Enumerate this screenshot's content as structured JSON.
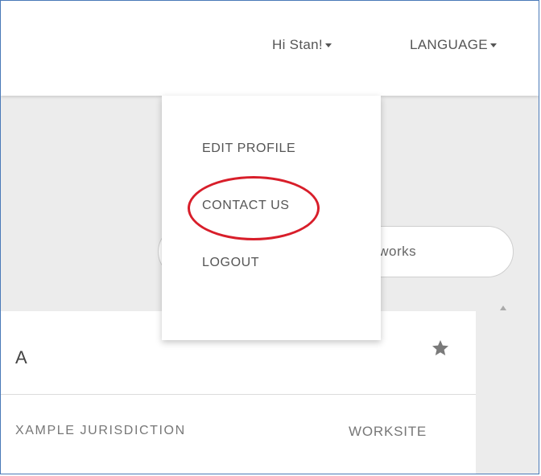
{
  "header": {
    "greeting": "Hi Stan!",
    "language_label": "LANGUAGE"
  },
  "user_menu": {
    "items": [
      {
        "label": "EDIT PROFILE"
      },
      {
        "label": "CONTACT US"
      },
      {
        "label": "LOGOUT"
      }
    ]
  },
  "search": {
    "visible_text": "tworks"
  },
  "card": {
    "title": "A",
    "jurisdiction": "XAMPLE JURISDICTION",
    "worksite": "WORKSITE",
    "favorite_icon": "star-icon"
  },
  "annotation": {
    "highlight_color": "#d81e2a"
  }
}
